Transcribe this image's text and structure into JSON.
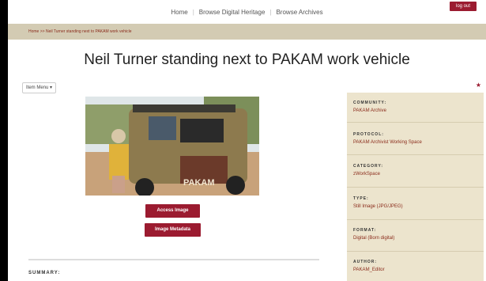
{
  "nav": {
    "links": [
      "Home",
      "Browse Digital Heritage",
      "Browse Archives"
    ],
    "logout_label": "LOG OUT"
  },
  "breadcrumb": "Home >> Neil Turner standing next to PAKAM work vehicle",
  "page_title": "Neil Turner standing next to PAKAM work vehicle",
  "item_menu_label": "Item Menu ▾",
  "star_icon": "star-icon",
  "photo": {
    "vehicle_text": "PAKAM"
  },
  "buttons": {
    "access": "Access Image",
    "metadata": "Image Metadata"
  },
  "summary_heading": "SUMMARY:",
  "metadata": [
    {
      "label": "COMMUNITY:",
      "value": "PAKAM Archive"
    },
    {
      "label": "PROTOCOL:",
      "value": "PAKAM Archivist Working Space"
    },
    {
      "label": "CATEGORY:",
      "value": "zWorkSpace"
    },
    {
      "label": "TYPE:",
      "value": "Still Image (JPG/JPEG)"
    },
    {
      "label": "FORMAT:",
      "value": "Digital (Born digital)"
    },
    {
      "label": "AUTHOR:",
      "value": "PAKAM_Editor"
    }
  ],
  "colors": {
    "accent": "#9b1b30",
    "breadcrumb_bar": "#d3cbb3",
    "sidebar_bg": "#ece4cd",
    "link": "#8a2b1b"
  }
}
